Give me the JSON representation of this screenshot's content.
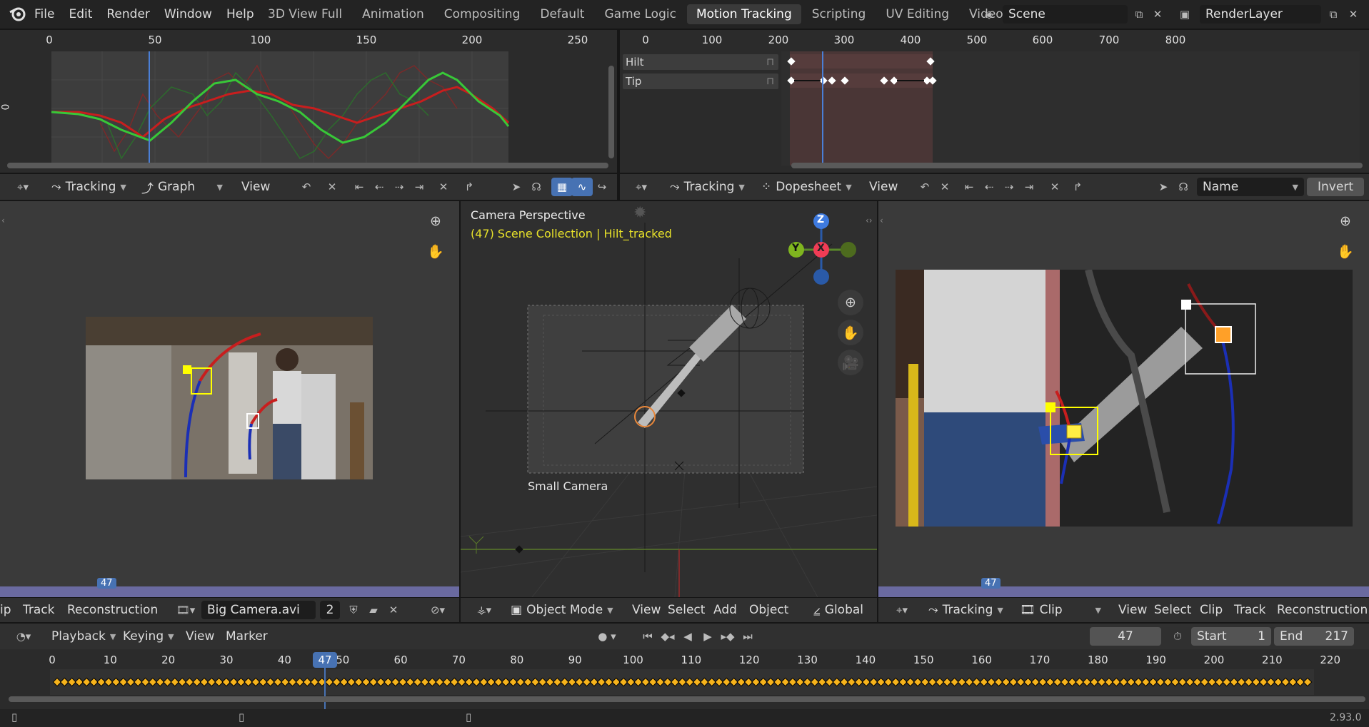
{
  "topbar": {
    "menus": [
      "File",
      "Edit",
      "Render",
      "Window",
      "Help"
    ],
    "workspaces": [
      "3D View Full",
      "Animation",
      "Compositing",
      "Default",
      "Game Logic",
      "Motion Tracking",
      "Scripting",
      "UV Editing",
      "Video Editing"
    ],
    "active_workspace": "Motion Tracking",
    "scene": "Scene",
    "render_layer": "RenderLayer"
  },
  "graph_editor": {
    "ruler": [
      "0",
      "50",
      "100",
      "150",
      "200",
      "250"
    ],
    "y_label": "0",
    "header": {
      "mode": "Tracking",
      "view_type": "Graph",
      "view_menu": "View"
    }
  },
  "dopesheet": {
    "ruler": [
      "0",
      "100",
      "200",
      "300",
      "400",
      "500",
      "600",
      "700",
      "800"
    ],
    "channels": [
      "Hilt",
      "Tip"
    ],
    "header": {
      "mode": "Tracking",
      "view_type": "Dopesheet",
      "view_menu": "View",
      "sort": "Name",
      "invert": "Invert"
    }
  },
  "left_clip": {
    "frame_badge": "47",
    "header": {
      "menus": [
        "ip",
        "Track",
        "Reconstruction"
      ],
      "clip_name": "Big Camera.avi",
      "users": "2"
    }
  },
  "viewport": {
    "perspective": "Camera Perspective",
    "collection": "(47) Scene Collection | Hilt_tracked",
    "camera_label": "Small Camera",
    "gizmo": {
      "z": "Z",
      "y": "Y",
      "x": "X"
    },
    "header": {
      "mode": "Object Mode",
      "menus": [
        "View",
        "Select",
        "Add",
        "Object"
      ],
      "orientation": "Global"
    }
  },
  "right_clip": {
    "frame_badge": "47",
    "header": {
      "mode": "Tracking",
      "view_type": "Clip",
      "menus": [
        "View",
        "Select",
        "Clip",
        "Track",
        "Reconstruction"
      ]
    }
  },
  "timeline": {
    "menus": [
      "Playback",
      "Keying",
      "View",
      "Marker"
    ],
    "current_frame": "47",
    "start_label": "Start",
    "start": "1",
    "end_label": "End",
    "end": "217",
    "ruler": [
      "0",
      "10",
      "20",
      "30",
      "40",
      "50",
      "60",
      "70",
      "80",
      "90",
      "100",
      "110",
      "120",
      "130",
      "140",
      "150",
      "160",
      "170",
      "180",
      "190",
      "200",
      "210",
      "220"
    ],
    "playhead_label": "47"
  },
  "statusbar": {
    "version": "2.93.0"
  },
  "colors": {
    "accent": "#4772b3",
    "keyframe": "#f6b31c",
    "track_red": "#c81e1e",
    "track_green": "#38c838",
    "track_blue": "#1b2fb5",
    "marker_yellow": "#ffff00",
    "selection": "#ffa028"
  }
}
